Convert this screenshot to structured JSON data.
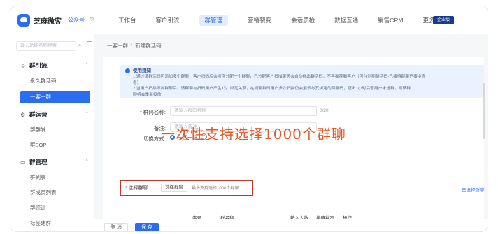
{
  "app": {
    "brand": "芝麻微客",
    "account": "公众号"
  },
  "nav": [
    "工作台",
    "客户引流",
    "群管理",
    "营销裂变",
    "会话质检",
    "数据互通",
    "销售CRM",
    "更多 ⌄"
  ],
  "nav_active": 2,
  "badge": "企业版",
  "sidebar": {
    "search_placeholder": "输入功能名称搜索",
    "groups": [
      {
        "label": "群引流",
        "icon": "people-icon",
        "items": [
          "永久群活码",
          "一客一群"
        ]
      },
      {
        "label": "群运营",
        "icon": "gear-icon",
        "items": [
          "群群发",
          "群SOP"
        ]
      },
      {
        "label": "群管理",
        "icon": "chat-icon",
        "items": [
          "群列表",
          "群成员列表",
          "群统计",
          "标签建群"
        ]
      }
    ],
    "active_item": "一客一群"
  },
  "breadcrumb": {
    "parent": "一客一群",
    "current": "新建群活码"
  },
  "notice": {
    "title": "使用须知",
    "lines": [
      "1.通过该群活码可添加多个群聊，客户扫码后会按序分配一个群聊，已分配客户扫描聊天会自动标出群活码，不再推荐新客户（可在到期群活码-已接待群聊已接中查",
      "看）",
      "2.当用户扫描添加群聊后，该群聊与扫码用户产生1对1绑定关系，在摘聊群时用户多次扫描仍会展示与其绑定的群聊码，超出1小时后若用户未进群，则该群",
      "聊将会重新投放"
    ]
  },
  "form": {
    "name_label": "* 群码名称:",
    "name_placeholder": "请输入群码名称",
    "name_count": "0/20",
    "note_label": "备注:",
    "note_placeholder": "请输入备注",
    "switch_label": "切换方式:",
    "switch_option": "一客一群",
    "select_label": "* 选择群聊:",
    "select_button": "选择群聊",
    "select_hint": "最多支持选择1000个群聊",
    "chosen_link": "已选择群聊"
  },
  "overlay": "一次性支持选择1000个群聊",
  "table": {
    "headers": [
      "序号",
      "群名称",
      "新入人数",
      "接待状态",
      "操作"
    ]
  },
  "footer": {
    "cancel": "取 消",
    "save": "保 存"
  }
}
